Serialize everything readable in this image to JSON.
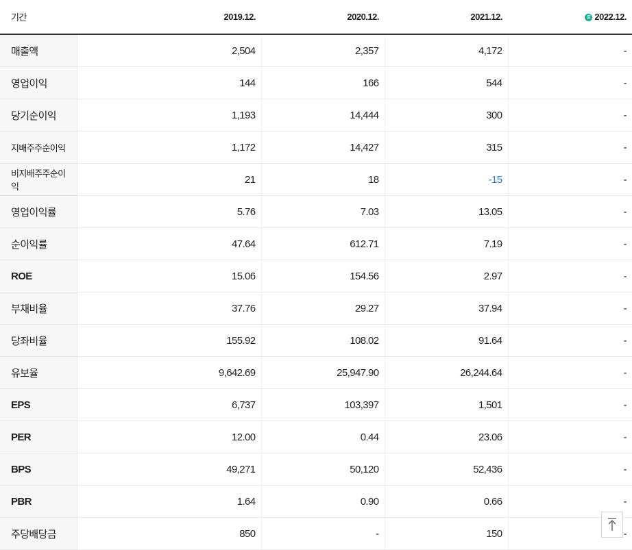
{
  "header": {
    "label": "기간",
    "periods": [
      "2019.12.",
      "2020.12.",
      "2021.12.",
      "2022.12."
    ],
    "estimate_mark": "E"
  },
  "rows": [
    {
      "label": "매출액",
      "values": [
        "2,504",
        "2,357",
        "4,172",
        "-"
      ]
    },
    {
      "label": "영업이익",
      "values": [
        "144",
        "166",
        "544",
        "-"
      ]
    },
    {
      "label": "당기순이익",
      "values": [
        "1,193",
        "14,444",
        "300",
        "-"
      ]
    },
    {
      "label": "지배주주순이익",
      "values": [
        "1,172",
        "14,427",
        "315",
        "-"
      ]
    },
    {
      "label": "비지배주주순이익",
      "values": [
        "21",
        "18",
        "-15",
        "-"
      ]
    },
    {
      "label": "영업이익률",
      "values": [
        "5.76",
        "7.03",
        "13.05",
        "-"
      ]
    },
    {
      "label": "순이익률",
      "values": [
        "47.64",
        "612.71",
        "7.19",
        "-"
      ]
    },
    {
      "label": "ROE",
      "values": [
        "15.06",
        "154.56",
        "2.97",
        "-"
      ]
    },
    {
      "label": "부채비율",
      "values": [
        "37.76",
        "29.27",
        "37.94",
        "-"
      ]
    },
    {
      "label": "당좌비율",
      "values": [
        "155.92",
        "108.02",
        "91.64",
        "-"
      ]
    },
    {
      "label": "유보율",
      "values": [
        "9,642.69",
        "25,947.90",
        "26,244.64",
        "-"
      ]
    },
    {
      "label": "EPS",
      "values": [
        "6,737",
        "103,397",
        "1,501",
        "-"
      ]
    },
    {
      "label": "PER",
      "values": [
        "12.00",
        "0.44",
        "23.06",
        "-"
      ]
    },
    {
      "label": "BPS",
      "values": [
        "49,271",
        "50,120",
        "52,436",
        "-"
      ]
    },
    {
      "label": "PBR",
      "values": [
        "1.64",
        "0.90",
        "0.66",
        "-"
      ]
    },
    {
      "label": "주당배당금",
      "values": [
        "850",
        "-",
        "150",
        "-"
      ]
    }
  ],
  "colors": {
    "negative": "#2d78d4",
    "estimate_badge": "#1bb08c"
  },
  "icons": {
    "scroll_top": "arrow-up-to-top-icon"
  }
}
